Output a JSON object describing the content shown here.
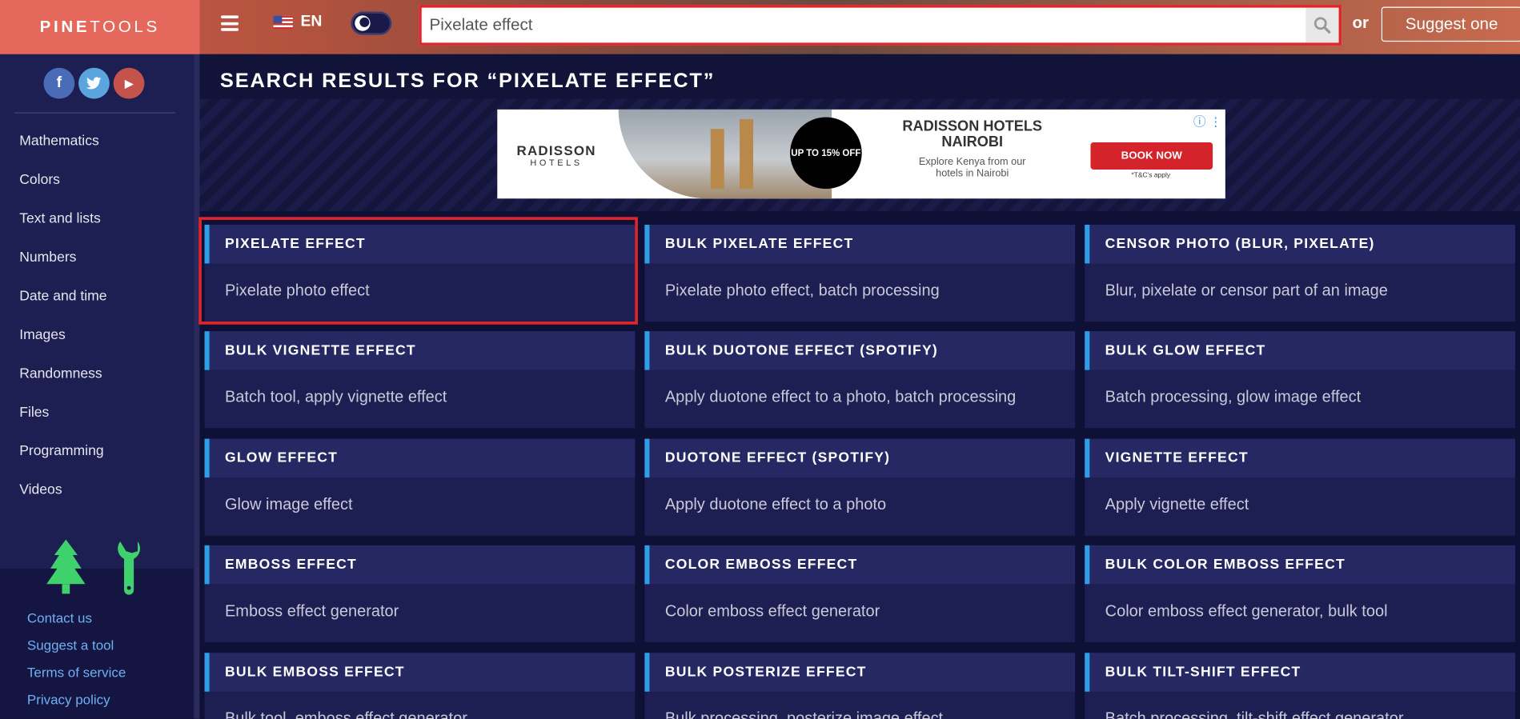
{
  "header": {
    "logo_bold": "PINE",
    "logo_light": "TOOLS",
    "language": "EN",
    "search_value": "Pixelate effect",
    "or_label": "or",
    "suggest_label": "Suggest one"
  },
  "social": {
    "facebook": "f",
    "twitter": "t",
    "youtube": "▶"
  },
  "sidebar": {
    "items": [
      {
        "label": "Mathematics"
      },
      {
        "label": "Colors"
      },
      {
        "label": "Text and lists"
      },
      {
        "label": "Numbers"
      },
      {
        "label": "Date and time"
      },
      {
        "label": "Images"
      },
      {
        "label": "Randomness"
      },
      {
        "label": "Files"
      },
      {
        "label": "Programming"
      },
      {
        "label": "Videos"
      }
    ],
    "links": [
      {
        "label": "Contact us"
      },
      {
        "label": "Suggest a tool"
      },
      {
        "label": "Terms of service"
      },
      {
        "label": "Privacy policy"
      }
    ]
  },
  "main": {
    "title": "SEARCH RESULTS FOR “PIXELATE EFFECT”",
    "ad": {
      "brand": "RADISSON",
      "brand_sub": "HOTELS",
      "badge": "UP TO 15% OFF",
      "headline": "RADISSON HOTELS NAIROBI",
      "sub": "Explore Kenya from our hotels in Nairobi",
      "cta": "BOOK NOW",
      "small": "*T&C's apply"
    },
    "results": [
      {
        "title": "PIXELATE EFFECT",
        "desc": "Pixelate photo effect"
      },
      {
        "title": "BULK PIXELATE EFFECT",
        "desc": "Pixelate photo effect, batch processing"
      },
      {
        "title": "CENSOR PHOTO (BLUR, PIXELATE)",
        "desc": "Blur, pixelate or censor part of an image"
      },
      {
        "title": "BULK VIGNETTE EFFECT",
        "desc": "Batch tool, apply vignette effect"
      },
      {
        "title": "BULK DUOTONE EFFECT (SPOTIFY)",
        "desc": "Apply duotone effect to a photo, batch processing"
      },
      {
        "title": "BULK GLOW EFFECT",
        "desc": "Batch processing, glow image effect"
      },
      {
        "title": "GLOW EFFECT",
        "desc": "Glow image effect"
      },
      {
        "title": "DUOTONE EFFECT (SPOTIFY)",
        "desc": "Apply duotone effect to a photo"
      },
      {
        "title": "VIGNETTE EFFECT",
        "desc": "Apply vignette effect"
      },
      {
        "title": "EMBOSS EFFECT",
        "desc": "Emboss effect generator"
      },
      {
        "title": "COLOR EMBOSS EFFECT",
        "desc": "Color emboss effect generator"
      },
      {
        "title": "BULK COLOR EMBOSS EFFECT",
        "desc": "Color emboss effect generator, bulk tool"
      },
      {
        "title": "BULK EMBOSS EFFECT",
        "desc": "Bulk tool, emboss effect generator"
      },
      {
        "title": "BULK POSTERIZE EFFECT",
        "desc": "Bulk processing, posterize image effect"
      },
      {
        "title": "BULK TILT-SHIFT EFFECT",
        "desc": "Batch processing, tilt-shift effect generator"
      }
    ]
  },
  "colors": {
    "accent_blue": "#2e9ee8",
    "highlight_red": "#e0242b",
    "card_bg": "#1d1e52",
    "logo_bg": "#e5685c"
  }
}
